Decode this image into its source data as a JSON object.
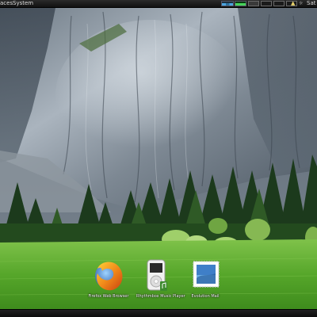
{
  "top_panel": {
    "menus": [
      {
        "label": "aces"
      },
      {
        "label": "System"
      }
    ],
    "clock_text": "Sat ,",
    "tray_icons": [
      "network-monitor-icon",
      "cpu-monitor-icon",
      "workspace-1",
      "workspace-2",
      "workspace-3",
      "workspace-4",
      "user-icon",
      "clock-icon"
    ]
  },
  "dock": {
    "items": [
      {
        "label": "Firefox Web Browser",
        "icon": "firefox-icon"
      },
      {
        "label": "Rhythmbox Music Player",
        "icon": "ipod-music-player-icon"
      },
      {
        "label": "Evolution Mail",
        "icon": "mail-stamp-icon"
      }
    ]
  },
  "wallpaper": {
    "subject": "granite-cliff-forest-meadow"
  }
}
